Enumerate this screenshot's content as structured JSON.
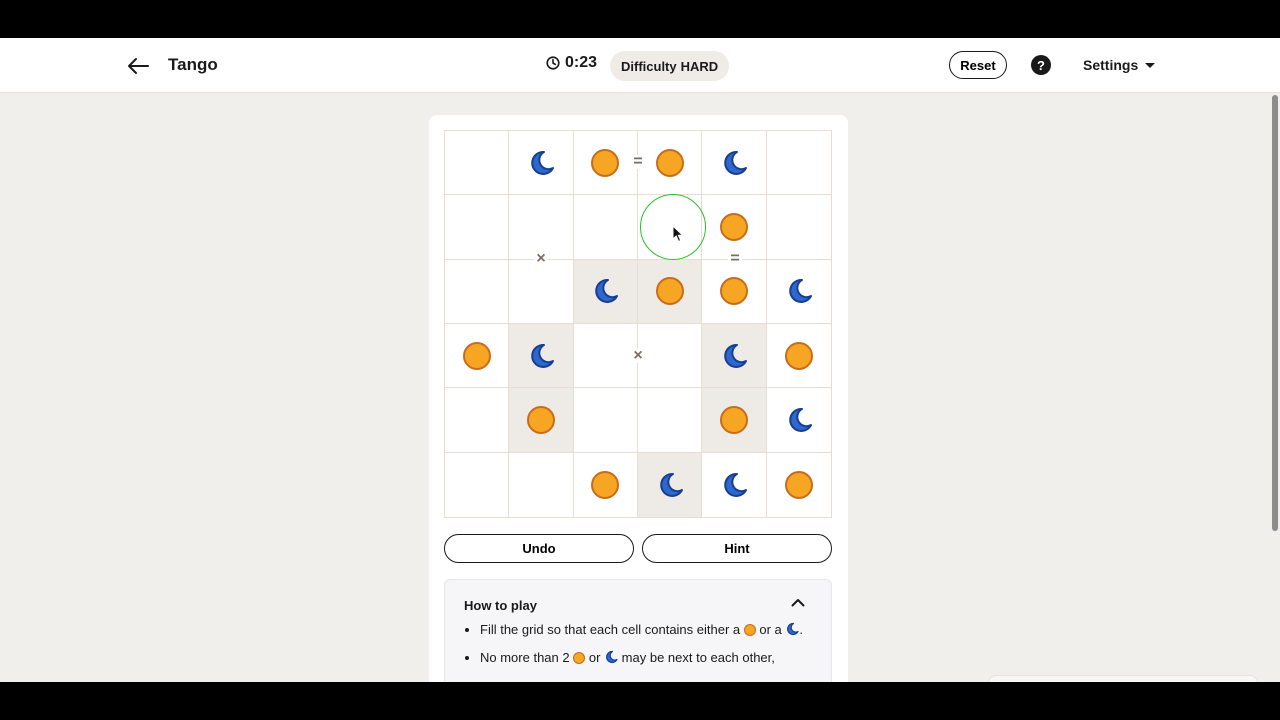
{
  "header": {
    "title": "Tango",
    "timer": "0:23",
    "difficulty_label": "Difficulty",
    "difficulty_value": "HARD",
    "reset_label": "Reset",
    "help_label": "?",
    "settings_label": "Settings"
  },
  "grid": {
    "size": 6,
    "cells": [
      [
        "",
        "moon",
        "sun",
        "sun",
        "moon",
        ""
      ],
      [
        "",
        "",
        "",
        "",
        "sun",
        ""
      ],
      [
        "",
        "",
        "moon",
        "sun",
        "sun",
        "moon"
      ],
      [
        "sun",
        "moon",
        "",
        "",
        "moon",
        "sun"
      ],
      [
        "",
        "sun",
        "",
        "",
        "sun",
        "moon"
      ],
      [
        "",
        "",
        "sun",
        "moon",
        "moon",
        "sun"
      ]
    ],
    "locked": [
      [
        false,
        false,
        false,
        false,
        false,
        false
      ],
      [
        false,
        false,
        false,
        false,
        false,
        false
      ],
      [
        false,
        false,
        true,
        true,
        false,
        false
      ],
      [
        false,
        true,
        false,
        false,
        true,
        false
      ],
      [
        false,
        true,
        false,
        false,
        true,
        false
      ],
      [
        false,
        false,
        false,
        true,
        false,
        false
      ]
    ],
    "constraints": [
      {
        "between": [
          [
            0,
            2
          ],
          [
            0,
            3
          ]
        ],
        "symbol": "="
      },
      {
        "between": [
          [
            1,
            1
          ],
          [
            2,
            1
          ]
        ],
        "symbol": "×"
      },
      {
        "between": [
          [
            1,
            4
          ],
          [
            2,
            4
          ]
        ],
        "symbol": "="
      },
      {
        "between": [
          [
            3,
            2
          ],
          [
            3,
            3
          ]
        ],
        "symbol": "×"
      }
    ],
    "highlighted_cell": [
      1,
      3
    ]
  },
  "actions": {
    "undo_label": "Undo",
    "hint_label": "Hint"
  },
  "how_to_play": {
    "title": "How to play",
    "rule1_prefix": "Fill the grid so that each cell contains either a",
    "rule1_middle": "or a",
    "rule1_suffix": ".",
    "rule2_prefix": "No more than 2",
    "rule2_middle": "or",
    "rule2_suffix": "may be next to each other,"
  },
  "colors": {
    "sun_fill": "#f6a623",
    "sun_stroke": "#c96c1a",
    "moon_fill": "#2f67cf",
    "moon_stroke": "#163f8f",
    "locked_cell": "#eeeae6",
    "highlight": "#2cc02c"
  },
  "icons": {
    "back": "arrow-left-icon",
    "timer": "clock-icon",
    "help": "question-circle-icon",
    "settings": "caret-down-icon",
    "sun": "sun-icon",
    "moon": "moon-icon",
    "collapse": "chevron-up-icon"
  }
}
